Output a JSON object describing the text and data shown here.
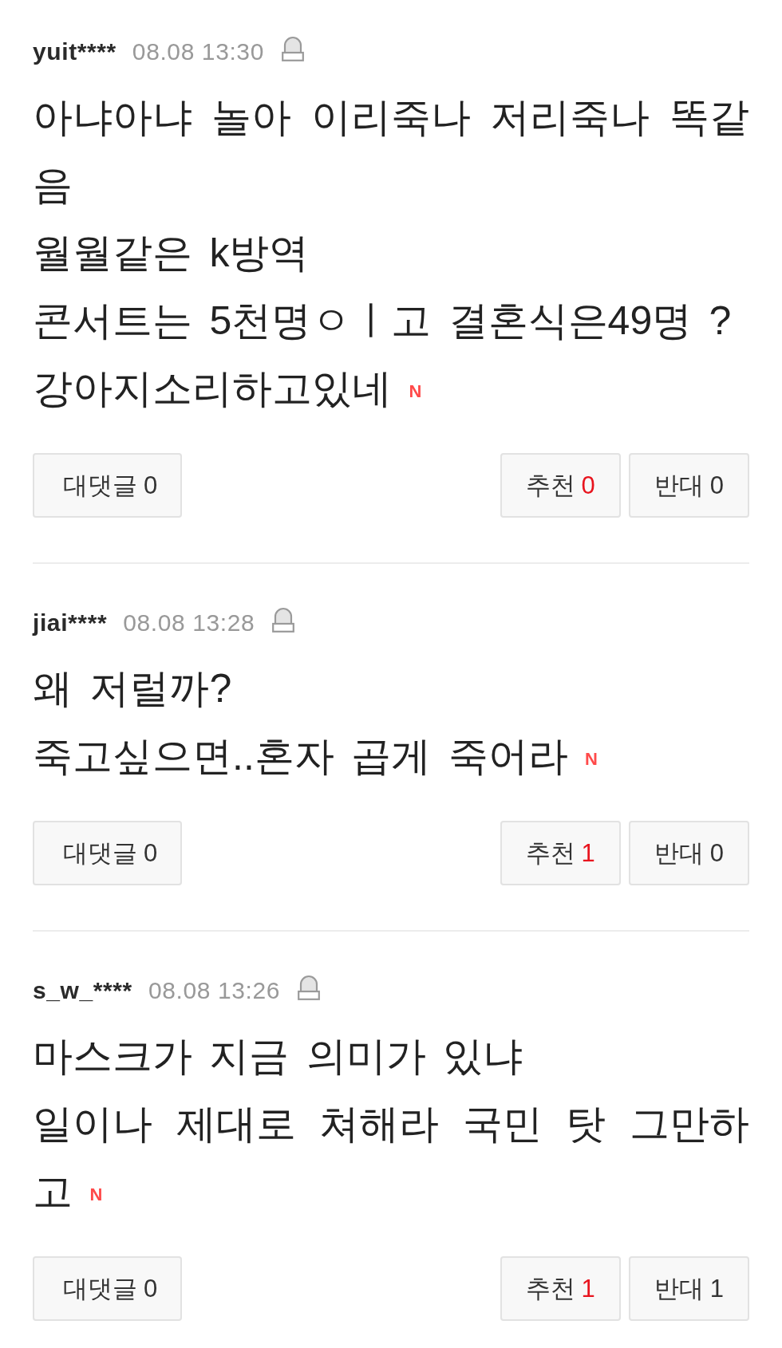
{
  "comments": [
    {
      "author": "yuit****",
      "time": "08.08 13:30",
      "text": "아냐아냐 놀아 이리죽나 저리죽나 똑같음\n월월같은 k방역\n콘서트는 5천명ㅇㅣ고 결혼식은49명 ?\n강아지소리하고있네 **N**",
      "buttons": [
        {
          "kind": "reply",
          "label": "대댓글",
          "count": "0"
        },
        {
          "kind": "like",
          "label": "추천",
          "count": "0"
        },
        {
          "kind": "dislike",
          "label": "반대",
          "count": "0"
        }
      ]
    },
    {
      "author": "jiai****",
      "time": "08.08 13:28",
      "text": "왜 저럴까?\n죽고싶으면..혼자 곱게 죽어라 **N**",
      "buttons": [
        {
          "kind": "reply",
          "label": "대댓글",
          "count": "0"
        },
        {
          "kind": "like",
          "label": "추천",
          "count": "1"
        },
        {
          "kind": "dislike",
          "label": "반대",
          "count": "0"
        }
      ]
    },
    {
      "author": "s_w_****",
      "time": "08.08 13:26",
      "text": "마스크가 지금 의미가 있냐\n일이나 제대로 쳐해라 국민 탓 그만하고 **N**",
      "buttons": [
        {
          "kind": "reply",
          "label": "대댓글",
          "count": "0"
        },
        {
          "kind": "like",
          "label": "추천",
          "count": "1"
        },
        {
          "kind": "dislike",
          "label": "반대",
          "count": "1"
        }
      ]
    }
  ]
}
